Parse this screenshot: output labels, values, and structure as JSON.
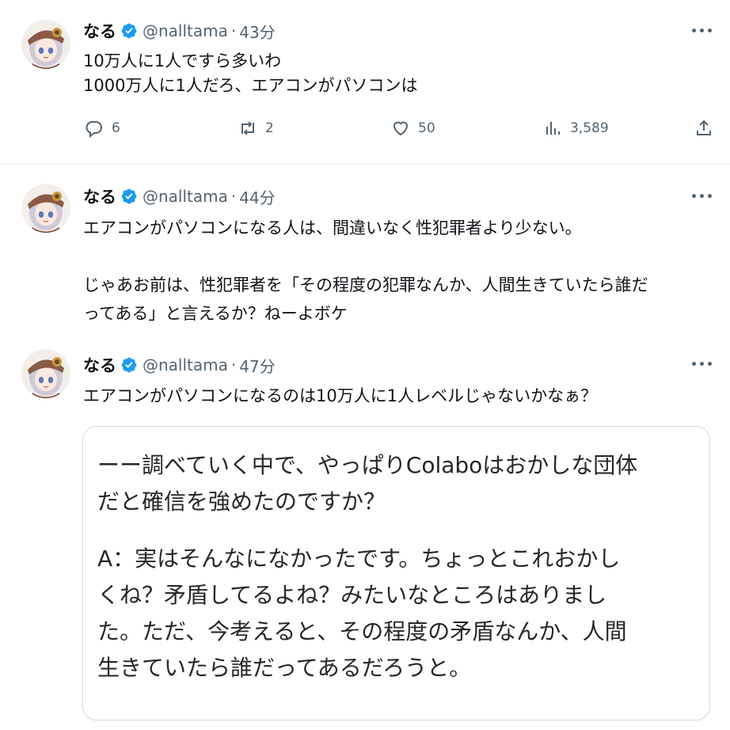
{
  "tweets": [
    {
      "name": "なる",
      "handle": "@nalltama",
      "separator": "·",
      "time": "43分",
      "lines": [
        "10万人に1人ですら多いわ",
        "1000万人に1人だろ、エアコンがパソコンは"
      ],
      "actions": {
        "reply": "6",
        "retweet": "2",
        "like": "50",
        "views": "3,589"
      }
    },
    {
      "name": "なる",
      "handle": "@nalltama",
      "separator": "·",
      "time": "44分",
      "lines": [
        "エアコンがパソコンになる人は、間違いなく性犯罪者より少ない。",
        "",
        "じゃあお前は、性犯罪者を「その程度の犯罪なんか、人間生きていたら誰だ",
        "ってある」と言えるか？ねーよボケ"
      ]
    },
    {
      "name": "なる",
      "handle": "@nalltama",
      "separator": "·",
      "time": "47分",
      "lines": [
        "エアコンがパソコンになるのは10万人に1人レベルじゃないかなぁ？"
      ],
      "quote": {
        "para1": [
          "ーー調べていく中で、やっぱりColaboはおかしな団体",
          "だと確信を強めたのですか？"
        ],
        "para2": [
          "A：実はそんなになかったです。ちょっとこれおかし",
          "くね？矛盾してるよね？みたいなところはありまし",
          "た。ただ、今考えると、その程度の矛盾なんか、人間",
          "生きていたら誰だってあるだろうと。"
        ]
      }
    }
  ],
  "colors": {
    "verified": "#1d9bf0",
    "secondary": "#536471",
    "border": "#cfd9de"
  },
  "icons": [
    "verified-badge-icon",
    "more-options-icon",
    "reply-icon",
    "retweet-icon",
    "like-icon",
    "views-icon",
    "share-icon"
  ]
}
